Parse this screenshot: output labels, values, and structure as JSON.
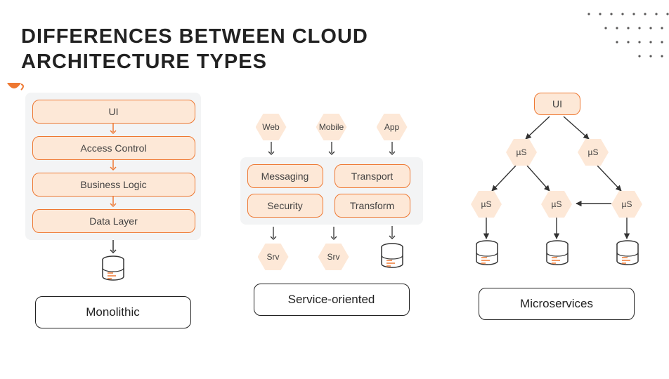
{
  "title_line1": "DIFFERENCES BETWEEN CLOUD",
  "title_line2": "ARCHITECTURE TYPES",
  "colors": {
    "accent": "#ee7832",
    "accent_fill": "#fde8d7",
    "panel": "#f3f4f5"
  },
  "columns": {
    "monolithic": {
      "label": "Monolithic",
      "layers": [
        "UI",
        "Access Control",
        "Business Logic",
        "Data Layer"
      ],
      "storage": "database"
    },
    "soa": {
      "label": "Service-oriented",
      "clients": [
        "Web",
        "Mobile",
        "App"
      ],
      "services": [
        "Messaging",
        "Transport",
        "Security",
        "Transform"
      ],
      "backends": [
        "Srv",
        "Srv",
        "database"
      ]
    },
    "micro": {
      "label": "Microservices",
      "root": "UI",
      "node_label": "µS",
      "nodes": 5,
      "databases": 3,
      "edges": [
        [
          "root",
          "n0"
        ],
        [
          "root",
          "n1"
        ],
        [
          "n0",
          "n2"
        ],
        [
          "n0",
          "n3"
        ],
        [
          "n1",
          "n4"
        ],
        [
          "n4",
          "n3"
        ],
        [
          "n2",
          "db0"
        ],
        [
          "n3",
          "db1"
        ],
        [
          "n4",
          "db2"
        ]
      ]
    }
  }
}
